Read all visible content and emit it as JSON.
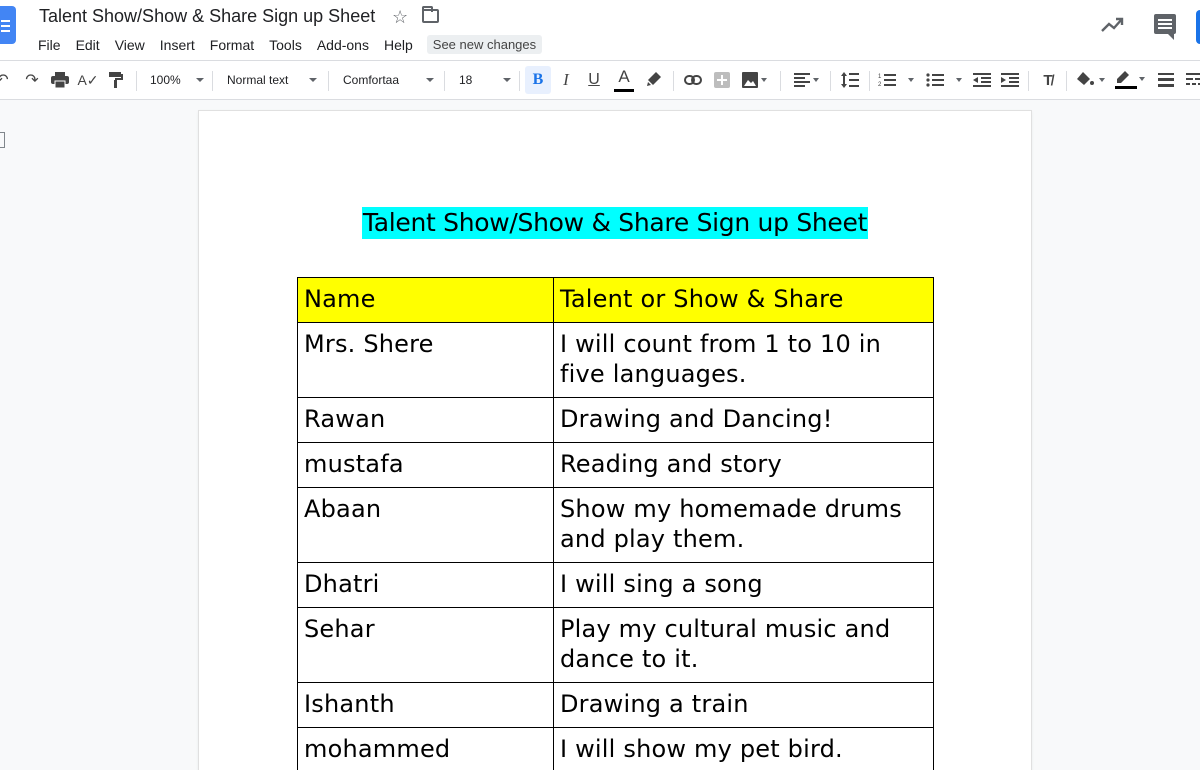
{
  "app": {
    "doc_title": "Talent Show/Show & Share Sign up Sheet",
    "menu": [
      "File",
      "Edit",
      "View",
      "Insert",
      "Format",
      "Tools",
      "Add-ons",
      "Help"
    ],
    "see_new_changes": "See new changes"
  },
  "toolbar": {
    "zoom": "100%",
    "style": "Normal text",
    "font": "Comfortaa",
    "font_size": "18",
    "bold_label": "B",
    "italic_label": "I",
    "underline_label": "U",
    "text_color_label": "A",
    "accent_color": "#1a73e8",
    "bold_active": true
  },
  "document": {
    "heading": "Talent Show/Show & Share Sign up Sheet",
    "heading_highlight": "#00ffff",
    "table_header_color": "#ffff00",
    "table": {
      "headers": [
        "Name",
        "Talent or Show & Share"
      ],
      "rows": [
        {
          "name": "Mrs. Shere",
          "talent": "I will count from 1 to 10 in five languages."
        },
        {
          "name": "Rawan",
          "talent": "Drawing and Dancing!"
        },
        {
          "name": "mustafa",
          "talent": "Reading and story"
        },
        {
          "name": "Abaan",
          "talent": "Show my homemade drums and play them."
        },
        {
          "name": "Dhatri",
          "talent": "I will sing a song"
        },
        {
          "name": "Sehar",
          "talent": "Play my cultural music and dance to it."
        },
        {
          "name": "Ishanth",
          "talent": "Drawing a train"
        },
        {
          "name": "mohammed",
          "talent": "I will show my pet bird."
        }
      ]
    }
  }
}
